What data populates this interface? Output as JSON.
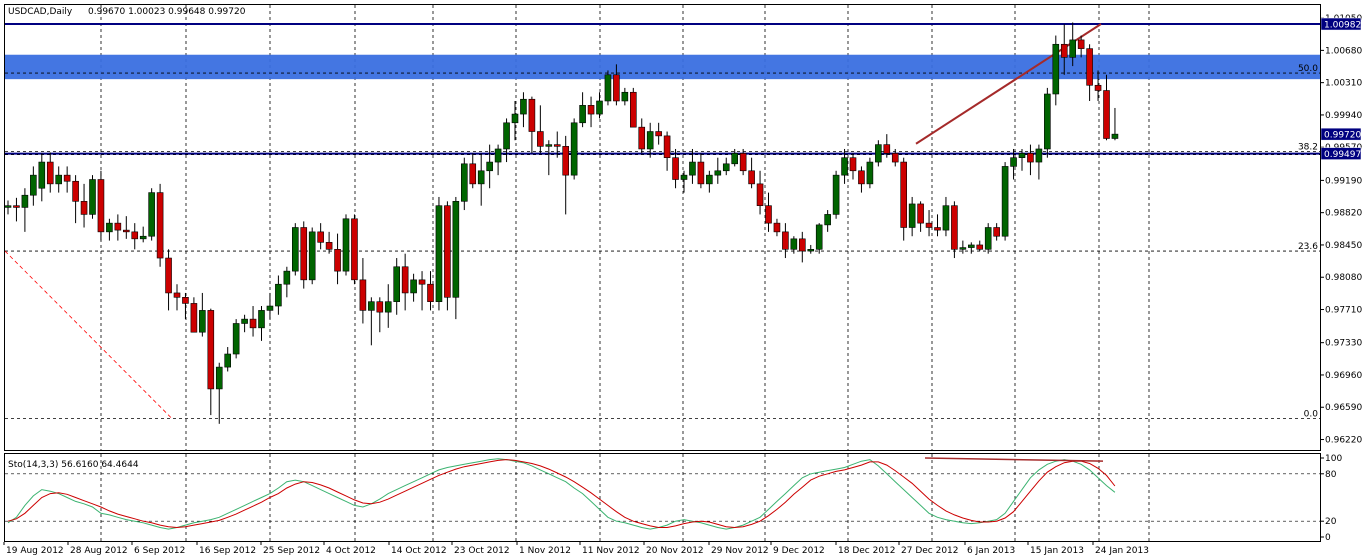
{
  "header": {
    "symbol": "USDCAD,Daily",
    "ohlc": "0.99670 1.00023 0.99648 0.99720"
  },
  "colors": {
    "bull": "#006400",
    "bear": "#cc0000",
    "zone": "#3a6fe0",
    "stoch_main": "#3cb371",
    "stoch_signal": "#cc0000",
    "trendline": "#a52a2a",
    "hline": "#000080"
  },
  "chart_data": [
    {
      "type": "candlestick",
      "title": "USDCAD,Daily",
      "ylim": [
        0.961,
        1.012
      ],
      "y_ticks": [
        "1.01050",
        "1.00680",
        "1.00310",
        "0.99940",
        "0.99570",
        "0.99190",
        "0.98820",
        "0.98450",
        "0.98080",
        "0.97710",
        "0.97330",
        "0.96960",
        "0.96590",
        "0.96220"
      ],
      "x_labels": [
        "19 Aug 2012",
        "28 Aug 2012",
        "6 Sep 2012",
        "16 Sep 2012",
        "25 Sep 2012",
        "4 Oct 2012",
        "14 Oct 2012",
        "23 Oct 2012",
        "1 Nov 2012",
        "11 Nov 2012",
        "20 Nov 2012",
        "29 Nov 2012",
        "9 Dec 2012",
        "18 Dec 2012",
        "27 Dec 2012",
        "6 Jan 2013",
        "15 Jan 2013",
        "24 Jan 2013"
      ],
      "price_tags": [
        {
          "value": 1.00982,
          "label": "1.00982"
        },
        {
          "value": 0.9972,
          "label": "0.99720"
        },
        {
          "value": 0.99497,
          "label": "0.99497"
        }
      ],
      "fib_levels": [
        {
          "label": "50.0",
          "value": 1.0042
        },
        {
          "label": "38.2",
          "value": 0.9952
        },
        {
          "label": "23.6",
          "value": 0.9838
        },
        {
          "label": "0.0",
          "value": 0.9646
        }
      ],
      "supply_zone": [
        1.0035,
        1.0063
      ],
      "candles": [
        [
          0.9888,
          0.9896,
          0.988,
          0.989
        ],
        [
          0.989,
          0.9899,
          0.9872,
          0.9888
        ],
        [
          0.9888,
          0.991,
          0.986,
          0.9902
        ],
        [
          0.9902,
          0.9935,
          0.989,
          0.9925
        ],
        [
          0.991,
          0.995,
          0.9895,
          0.994
        ],
        [
          0.994,
          0.9951,
          0.9905,
          0.9915
        ],
        [
          0.9915,
          0.9935,
          0.9905,
          0.9925
        ],
        [
          0.9925,
          0.9935,
          0.9905,
          0.9918
        ],
        [
          0.9918,
          0.9925,
          0.987,
          0.9895
        ],
        [
          0.9895,
          0.9915,
          0.9865,
          0.988
        ],
        [
          0.988,
          0.9925,
          0.9875,
          0.992
        ],
        [
          0.992,
          0.993,
          0.985,
          0.986
        ],
        [
          0.986,
          0.9875,
          0.985,
          0.987
        ],
        [
          0.987,
          0.988,
          0.985,
          0.9862
        ],
        [
          0.9862,
          0.9878,
          0.9852,
          0.986
        ],
        [
          0.986,
          0.987,
          0.984,
          0.9852
        ],
        [
          0.9852,
          0.9866,
          0.9848,
          0.9855
        ],
        [
          0.9855,
          0.991,
          0.985,
          0.9905
        ],
        [
          0.9905,
          0.9915,
          0.982,
          0.983
        ],
        [
          0.983,
          0.984,
          0.977,
          0.979
        ],
        [
          0.979,
          0.98,
          0.977,
          0.9785
        ],
        [
          0.9785,
          0.979,
          0.976,
          0.9778
        ],
        [
          0.9778,
          0.9785,
          0.9745,
          0.9745
        ],
        [
          0.9745,
          0.979,
          0.974,
          0.977
        ],
        [
          0.977,
          0.9772,
          0.965,
          0.968
        ],
        [
          0.968,
          0.971,
          0.964,
          0.9705
        ],
        [
          0.9705,
          0.9728,
          0.97,
          0.972
        ],
        [
          0.972,
          0.976,
          0.9715,
          0.9755
        ],
        [
          0.9755,
          0.9765,
          0.9745,
          0.976
        ],
        [
          0.976,
          0.9775,
          0.974,
          0.975
        ],
        [
          0.975,
          0.9775,
          0.9735,
          0.977
        ],
        [
          0.977,
          0.979,
          0.976,
          0.9775
        ],
        [
          0.9775,
          0.981,
          0.9765,
          0.98
        ],
        [
          0.98,
          0.982,
          0.9785,
          0.9815
        ],
        [
          0.9815,
          0.987,
          0.981,
          0.9865
        ],
        [
          0.9865,
          0.9872,
          0.9795,
          0.9805
        ],
        [
          0.9805,
          0.9865,
          0.98,
          0.986
        ],
        [
          0.986,
          0.987,
          0.984,
          0.9848
        ],
        [
          0.9848,
          0.986,
          0.9835,
          0.984
        ],
        [
          0.984,
          0.9858,
          0.98,
          0.9815
        ],
        [
          0.9815,
          0.988,
          0.981,
          0.9875
        ],
        [
          0.9875,
          0.988,
          0.98,
          0.9805
        ],
        [
          0.9805,
          0.983,
          0.9755,
          0.977
        ],
        [
          0.977,
          0.9785,
          0.973,
          0.978
        ],
        [
          0.978,
          0.9785,
          0.9745,
          0.9768
        ],
        [
          0.9768,
          0.98,
          0.975,
          0.978
        ],
        [
          0.978,
          0.983,
          0.9765,
          0.982
        ],
        [
          0.982,
          0.9835,
          0.977,
          0.979
        ],
        [
          0.979,
          0.9812,
          0.978,
          0.9805
        ],
        [
          0.9805,
          0.9815,
          0.977,
          0.98
        ],
        [
          0.98,
          0.9815,
          0.977,
          0.978
        ],
        [
          0.978,
          0.99,
          0.977,
          0.989
        ],
        [
          0.989,
          0.9895,
          0.977,
          0.9785
        ],
        [
          0.9785,
          0.99,
          0.976,
          0.9895
        ],
        [
          0.9895,
          0.9945,
          0.9885,
          0.9938
        ],
        [
          0.9938,
          0.995,
          0.991,
          0.9915
        ],
        [
          0.9915,
          0.995,
          0.989,
          0.993
        ],
        [
          0.993,
          0.996,
          0.991,
          0.994
        ],
        [
          0.994,
          0.996,
          0.9925,
          0.9955
        ],
        [
          0.9955,
          0.999,
          0.994,
          0.9985
        ],
        [
          0.9985,
          1.001,
          0.9965,
          0.9995
        ],
        [
          0.9995,
          1.002,
          0.998,
          1.0012
        ],
        [
          1.0012,
          1.0015,
          0.995,
          0.9975
        ],
        [
          0.9975,
          1.0005,
          0.995,
          0.9958
        ],
        [
          0.9958,
          0.9965,
          0.9925,
          0.996
        ],
        [
          0.996,
          0.9975,
          0.9945,
          0.9958
        ],
        [
          0.9958,
          0.997,
          0.988,
          0.9925
        ],
        [
          0.9925,
          0.999,
          0.992,
          0.9985
        ],
        [
          0.9985,
          1.002,
          0.998,
          1.0005
        ],
        [
          1.0005,
          1.0015,
          0.998,
          0.9995
        ],
        [
          0.9995,
          1.002,
          0.999,
          1.001
        ],
        [
          1.001,
          1.0045,
          1.0005,
          1.004
        ],
        [
          1.004,
          1.0052,
          1.0005,
          1.001
        ],
        [
          1.001,
          1.0025,
          1.0005,
          1.002
        ],
        [
          1.002,
          1.0025,
          0.999,
          0.998
        ],
        [
          0.998,
          0.999,
          0.995,
          0.9955
        ],
        [
          0.9955,
          0.9985,
          0.9945,
          0.9975
        ],
        [
          0.9975,
          0.9985,
          0.996,
          0.997
        ],
        [
          0.997,
          0.9975,
          0.993,
          0.9945
        ],
        [
          0.9945,
          0.9955,
          0.991,
          0.992
        ],
        [
          0.992,
          0.993,
          0.9905,
          0.9925
        ],
        [
          0.9925,
          0.9955,
          0.9915,
          0.994
        ],
        [
          0.994,
          0.995,
          0.991,
          0.9915
        ],
        [
          0.9915,
          0.993,
          0.9905,
          0.9925
        ],
        [
          0.9925,
          0.9945,
          0.9915,
          0.993
        ],
        [
          0.993,
          0.9945,
          0.9925,
          0.9938
        ],
        [
          0.9938,
          0.9955,
          0.9935,
          0.995
        ],
        [
          0.995,
          0.9955,
          0.9925,
          0.993
        ],
        [
          0.993,
          0.9945,
          0.991,
          0.9915
        ],
        [
          0.9915,
          0.993,
          0.988,
          0.989
        ],
        [
          0.989,
          0.9905,
          0.986,
          0.987
        ],
        [
          0.987,
          0.9875,
          0.9855,
          0.986
        ],
        [
          0.986,
          0.987,
          0.983,
          0.984
        ],
        [
          0.984,
          0.9855,
          0.9835,
          0.9852
        ],
        [
          0.9852,
          0.986,
          0.9825,
          0.9838
        ],
        [
          0.9838,
          0.9845,
          0.9835,
          0.984
        ],
        [
          0.984,
          0.987,
          0.9835,
          0.9868
        ],
        [
          0.9868,
          0.9885,
          0.986,
          0.988
        ],
        [
          0.988,
          0.993,
          0.9875,
          0.9925
        ],
        [
          0.9925,
          0.9955,
          0.9915,
          0.9945
        ],
        [
          0.9945,
          0.995,
          0.992,
          0.993
        ],
        [
          0.993,
          0.9935,
          0.9905,
          0.9915
        ],
        [
          0.9915,
          0.9945,
          0.991,
          0.994
        ],
        [
          0.994,
          0.9965,
          0.9935,
          0.996
        ],
        [
          0.996,
          0.9972,
          0.9945,
          0.995
        ],
        [
          0.995,
          0.9955,
          0.9935,
          0.994
        ],
        [
          0.994,
          0.9945,
          0.985,
          0.9865
        ],
        [
          0.9865,
          0.99,
          0.9855,
          0.9892
        ],
        [
          0.9892,
          0.9895,
          0.986,
          0.987
        ],
        [
          0.987,
          0.9885,
          0.9855,
          0.9865
        ],
        [
          0.9865,
          0.988,
          0.9855,
          0.9862
        ],
        [
          0.9862,
          0.99,
          0.9855,
          0.989
        ],
        [
          0.989,
          0.9895,
          0.983,
          0.984
        ],
        [
          0.984,
          0.985,
          0.9835,
          0.9842
        ],
        [
          0.9842,
          0.9848,
          0.9835,
          0.9845
        ],
        [
          0.9845,
          0.985,
          0.9838,
          0.984
        ],
        [
          0.984,
          0.987,
          0.9835,
          0.9865
        ],
        [
          0.9865,
          0.987,
          0.985,
          0.9855
        ],
        [
          0.9855,
          0.994,
          0.985,
          0.9935
        ],
        [
          0.9935,
          0.9955,
          0.992,
          0.9945
        ],
        [
          0.9945,
          0.9955,
          0.993,
          0.995
        ],
        [
          0.995,
          0.996,
          0.9925,
          0.994
        ],
        [
          0.994,
          0.996,
          0.992,
          0.9955
        ],
        [
          0.9955,
          1.0025,
          0.9945,
          1.0018
        ],
        [
          1.0018,
          1.0085,
          1.0005,
          1.0075
        ],
        [
          1.0075,
          1.0098,
          1.004,
          1.006
        ],
        [
          1.006,
          1.01,
          1.005,
          1.008
        ],
        [
          1.008,
          1.0085,
          1.006,
          1.007
        ],
        [
          1.007,
          1.0075,
          1.001,
          1.0028
        ],
        [
          1.0028,
          1.0045,
          1.001,
          1.0022
        ],
        [
          1.0022,
          1.004,
          0.9965,
          0.9967
        ],
        [
          0.9967,
          1.0002,
          0.9965,
          0.9972
        ]
      ]
    },
    {
      "type": "line",
      "title": "Sto(14,3,3) 56.6160 64.4644",
      "ylim": [
        0,
        100
      ],
      "y_ticks": [
        "100",
        "80",
        "20",
        "0"
      ],
      "series": [
        {
          "name": "main",
          "values": [
            18,
            25,
            40,
            52,
            60,
            58,
            55,
            50,
            45,
            42,
            38,
            30,
            28,
            25,
            22,
            20,
            18,
            15,
            12,
            10,
            12,
            15,
            18,
            20,
            22,
            25,
            30,
            35,
            40,
            45,
            50,
            55,
            62,
            70,
            72,
            70,
            65,
            60,
            55,
            50,
            45,
            40,
            38,
            42,
            48,
            55,
            60,
            65,
            70,
            75,
            80,
            85,
            88,
            90,
            92,
            94,
            96,
            98,
            99,
            98,
            96,
            94,
            90,
            85,
            80,
            75,
            70,
            62,
            55,
            45,
            35,
            25,
            20,
            18,
            15,
            12,
            10,
            12,
            15,
            20,
            22,
            20,
            18,
            15,
            12,
            10,
            12,
            15,
            20,
            25,
            35,
            45,
            55,
            65,
            75,
            80,
            82,
            84,
            86,
            88,
            92,
            96,
            98,
            90,
            80,
            70,
            60,
            50,
            40,
            30,
            25,
            22,
            20,
            18,
            17,
            18,
            20,
            22,
            30,
            45,
            60,
            75,
            85,
            92,
            96,
            98,
            96,
            92,
            85,
            75,
            65,
            56.6
          ]
        },
        {
          "name": "signal",
          "values": [
            20,
            23,
            30,
            40,
            50,
            55,
            56,
            54,
            50,
            46,
            42,
            38,
            33,
            29,
            26,
            23,
            20,
            18,
            15,
            13,
            12,
            13,
            15,
            17,
            19,
            21,
            25,
            29,
            34,
            39,
            44,
            50,
            55,
            62,
            67,
            70,
            69,
            66,
            62,
            57,
            52,
            47,
            43,
            42,
            44,
            48,
            53,
            58,
            63,
            68,
            73,
            78,
            82,
            86,
            89,
            91,
            93,
            95,
            97,
            98,
            97,
            95,
            93,
            90,
            86,
            81,
            76,
            70,
            63,
            56,
            48,
            40,
            32,
            25,
            20,
            17,
            14,
            12,
            12,
            14,
            17,
            19,
            20,
            19,
            16,
            13,
            12,
            13,
            16,
            20,
            27,
            35,
            44,
            54,
            63,
            72,
            77,
            80,
            83,
            85,
            88,
            91,
            95,
            95,
            91,
            84,
            76,
            68,
            58,
            48,
            40,
            33,
            28,
            24,
            21,
            19,
            19,
            20,
            24,
            32,
            45,
            58,
            71,
            82,
            89,
            94,
            96,
            96,
            93,
            87,
            78,
            64.5
          ]
        }
      ]
    }
  ]
}
